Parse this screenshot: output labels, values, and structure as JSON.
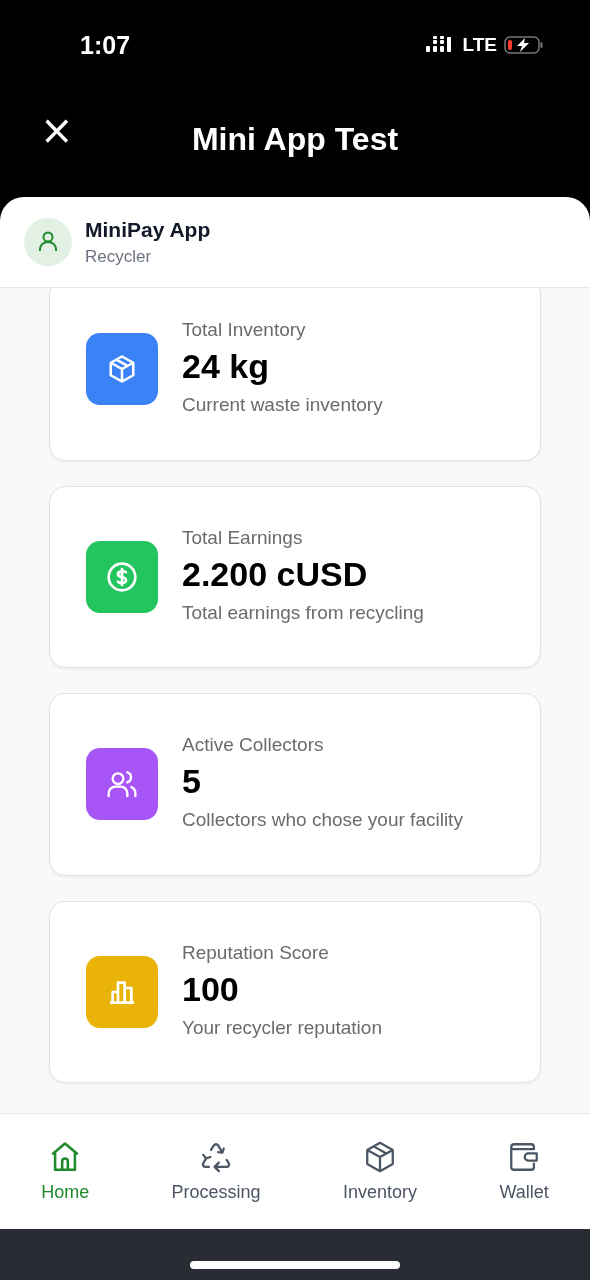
{
  "status_bar": {
    "time": "1:07",
    "network": "LTE"
  },
  "header": {
    "close": "×",
    "title": "Mini App Test"
  },
  "profile": {
    "name": "MiniPay App",
    "role": "Recycler"
  },
  "stats": [
    {
      "kind": "box",
      "color": "#3b82f6",
      "label": "Total Inventory",
      "value": "24 kg",
      "description": "Current waste inventory"
    },
    {
      "kind": "dollar",
      "color": "#22c55e",
      "label": "Total Earnings",
      "value": "2.200 cUSD",
      "description": "Total earnings from recycling"
    },
    {
      "kind": "users",
      "color": "#a855f7",
      "label": "Active Collectors",
      "value": "5",
      "description": "Collectors who chose your facility"
    },
    {
      "kind": "chart",
      "color": "#eab308",
      "label": "Reputation Score",
      "value": "100",
      "description": "Your recycler reputation"
    }
  ],
  "nav": [
    {
      "kind": "home",
      "label": "Home",
      "selected": true
    },
    {
      "kind": "recycle",
      "label": "Processing",
      "selected": false
    },
    {
      "kind": "box",
      "label": "Inventory",
      "selected": false
    },
    {
      "kind": "wallet",
      "label": "Wallet",
      "selected": false
    }
  ]
}
